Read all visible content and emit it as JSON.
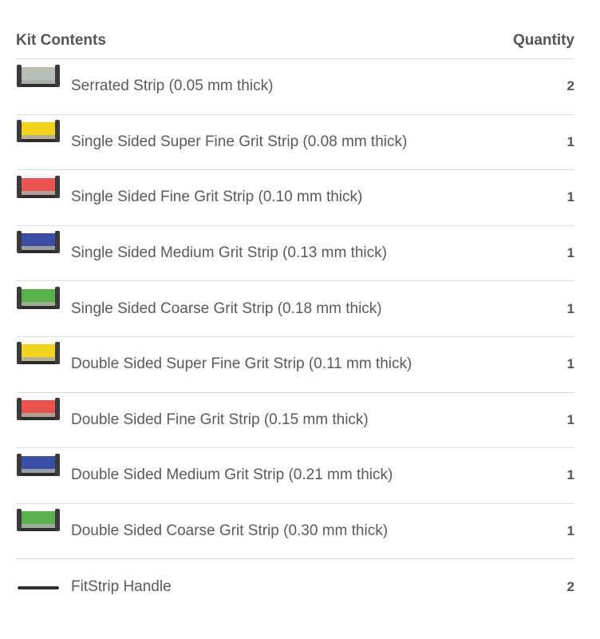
{
  "table": {
    "header": {
      "contents_label": "Kit Contents",
      "quantity_label": "Quantity"
    },
    "rows": [
      {
        "name": "Serrated Strip (0.05 mm thick)",
        "quantity": "2",
        "strip_color": "#b9bfb6",
        "icon": "strip-icon"
      },
      {
        "name": "Single Sided Super Fine Grit Strip (0.08 mm thick)",
        "quantity": "1",
        "strip_color": "#f2d21b",
        "icon": "strip-icon"
      },
      {
        "name": "Single Sided Fine Grit Strip (0.10 mm thick)",
        "quantity": "1",
        "strip_color": "#e8534d",
        "icon": "strip-icon"
      },
      {
        "name": "Single Sided Medium Grit Strip (0.13 mm thick)",
        "quantity": "1",
        "strip_color": "#3b4ea6",
        "icon": "strip-icon"
      },
      {
        "name": "Single Sided Coarse Grit Strip (0.18 mm thick)",
        "quantity": "1",
        "strip_color": "#5ab04a",
        "icon": "strip-icon"
      },
      {
        "name": "Double Sided Super Fine Grit Strip (0.11 mm thick)",
        "quantity": "1",
        "strip_color": "#f2d21b",
        "icon": "strip-icon"
      },
      {
        "name": "Double Sided Fine Grit Strip (0.15 mm thick)",
        "quantity": "1",
        "strip_color": "#e8534d",
        "icon": "strip-icon"
      },
      {
        "name": "Double Sided Medium Grit Strip (0.21 mm thick)",
        "quantity": "1",
        "strip_color": "#3b4ea6",
        "icon": "strip-icon"
      },
      {
        "name": "Double Sided Coarse Grit Strip (0.30 mm thick)",
        "quantity": "1",
        "strip_color": "#5ab04a",
        "icon": "strip-icon"
      },
      {
        "name": "FitStrip Handle",
        "quantity": "2",
        "strip_color": "#2f2f2f",
        "icon": "handle-icon"
      }
    ]
  }
}
